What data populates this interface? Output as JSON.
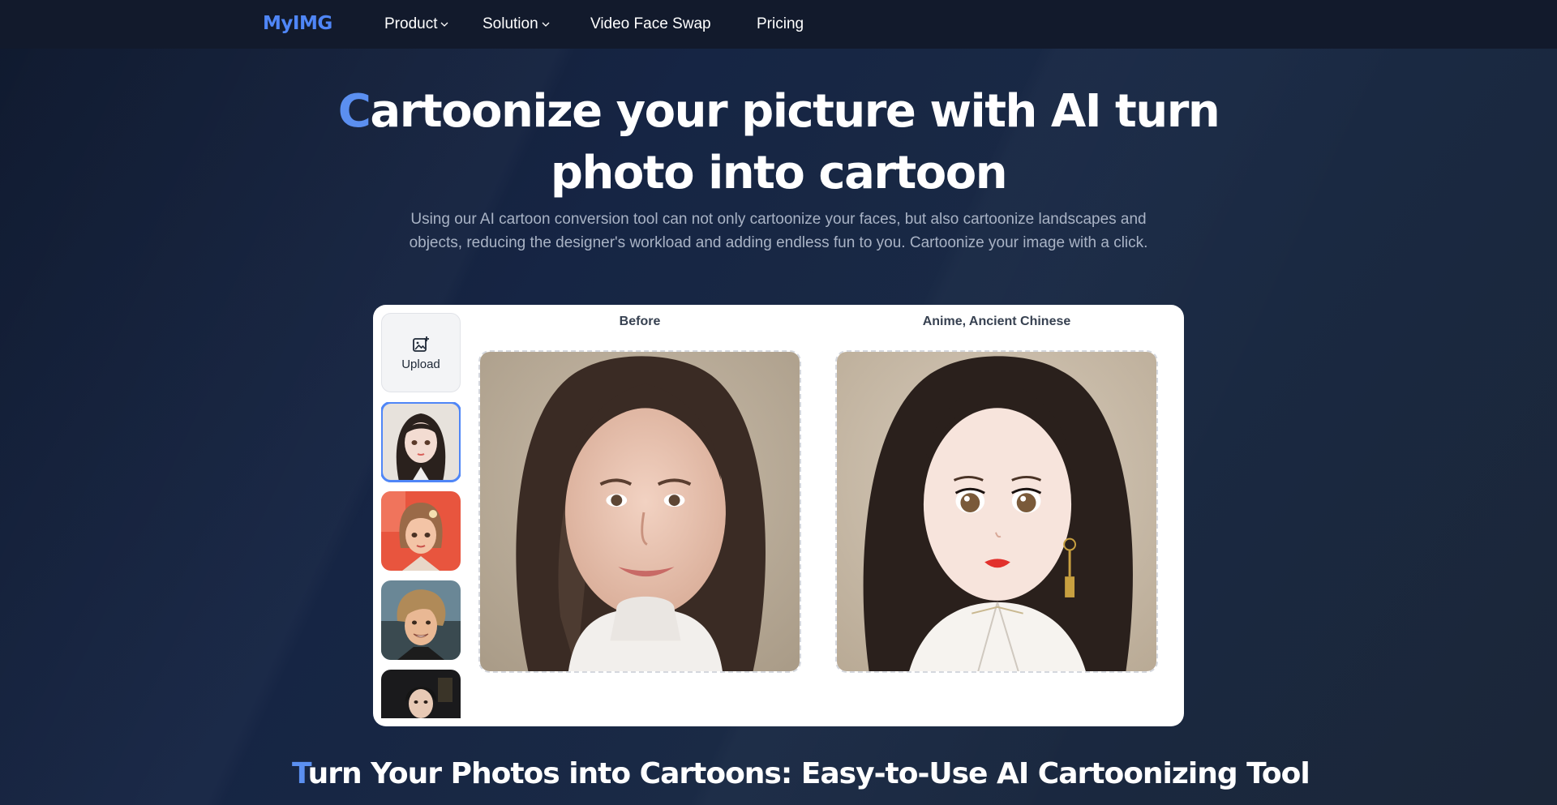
{
  "nav": {
    "logo": "MyIMG",
    "items": [
      {
        "label": "Product",
        "dropdown": true
      },
      {
        "label": "Solution",
        "dropdown": true
      },
      {
        "label": "Video Face Swap",
        "dropdown": false
      },
      {
        "label": "Pricing",
        "dropdown": false
      }
    ]
  },
  "hero": {
    "title_first_letter": "C",
    "title_rest_line1": "artoonize your picture with AI turn",
    "title_line2": "photo into cartoon",
    "subtitle": "Using our AI cartoon conversion tool can not only cartoonize your faces, but also cartoonize landscapes and objects, reducing the designer's workload and adding endless fun to you. Cartoonize your image with a click."
  },
  "tool": {
    "upload_label": "Upload",
    "upload_icon": "image-upload-icon",
    "thumbnails": [
      {
        "name": "anime-woman-sample",
        "selected": true
      },
      {
        "name": "3d-cartoon-girl-sample",
        "selected": false
      },
      {
        "name": "cartoon-man-sample",
        "selected": false
      },
      {
        "name": "anime-suit-man-sample",
        "selected": false
      }
    ],
    "before_label": "Before",
    "after_label": "Anime, Ancient Chinese"
  },
  "section": {
    "title_first_letter": "T",
    "title_rest": "urn Your Photos into Cartoons: Easy-to-Use AI Cartoonizing Tool"
  },
  "colors": {
    "accent": "#4f86f7",
    "nav_bg": "#121a2c",
    "page_bg": "#162544"
  }
}
